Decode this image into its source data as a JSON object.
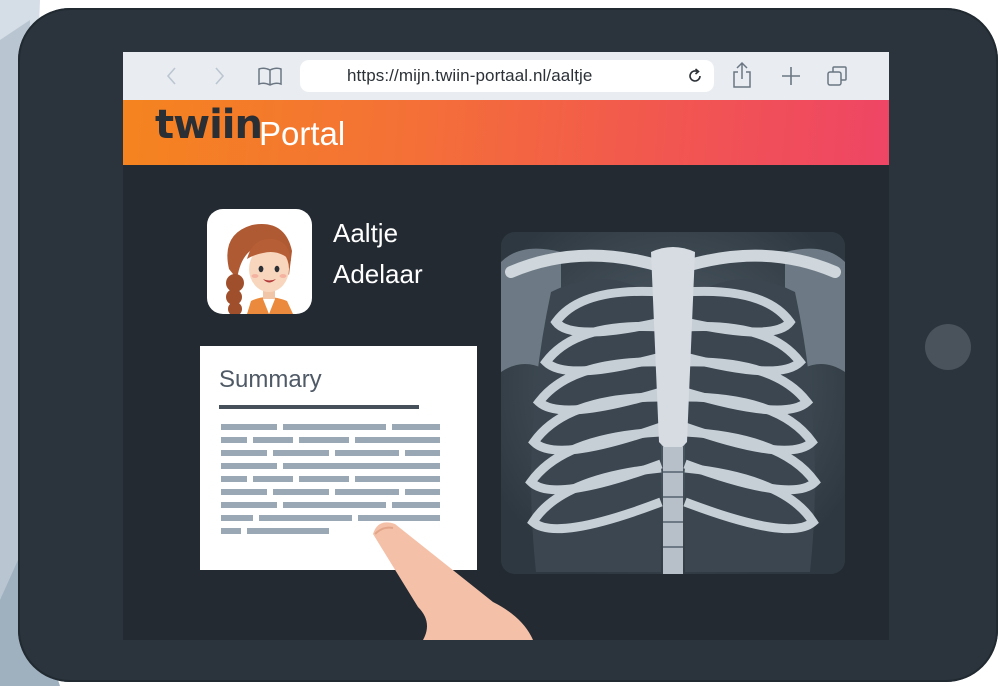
{
  "browser": {
    "url": "https://mijn.twiin-portaal.nl/aaltje"
  },
  "header": {
    "logo_text": "twiin",
    "title": "Portal"
  },
  "patient": {
    "first_name": "Aaltje",
    "last_name": "Adelaar"
  },
  "summary": {
    "title": "Summary"
  },
  "colors": {
    "header_start": "#f5841f",
    "header_end": "#ee4565",
    "tablet_frame": "#2b333c",
    "screen_bg": "#232a32",
    "browser_bar": "#e9edf2"
  }
}
